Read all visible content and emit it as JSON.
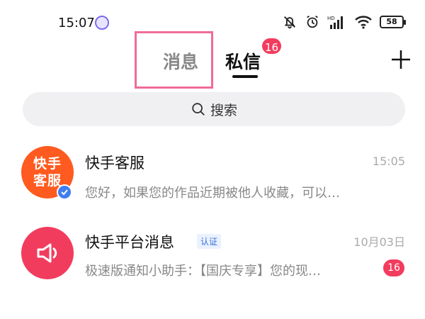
{
  "status_bar": {
    "time": "15:07",
    "battery": "58"
  },
  "header": {
    "tabs": [
      {
        "label": "消息"
      },
      {
        "label": "私信",
        "badge": "16"
      }
    ]
  },
  "search": {
    "placeholder": "搜索"
  },
  "conversations": [
    {
      "name": "快手客服",
      "avatar_text": [
        "快手",
        "客服"
      ],
      "preview": "您好，如果您的作品近期被他人收藏，可以…",
      "time": "15:05"
    },
    {
      "name": "快手平台消息",
      "tag": "认证",
      "preview": "极速版通知小助手：【国庆专享】您的现…",
      "time": "10月03日",
      "unread": "16"
    }
  ],
  "colors": {
    "accent": "#f23c5e",
    "kuaishou_orange": "#ff5a1f",
    "verified_blue": "#3f7df0"
  }
}
